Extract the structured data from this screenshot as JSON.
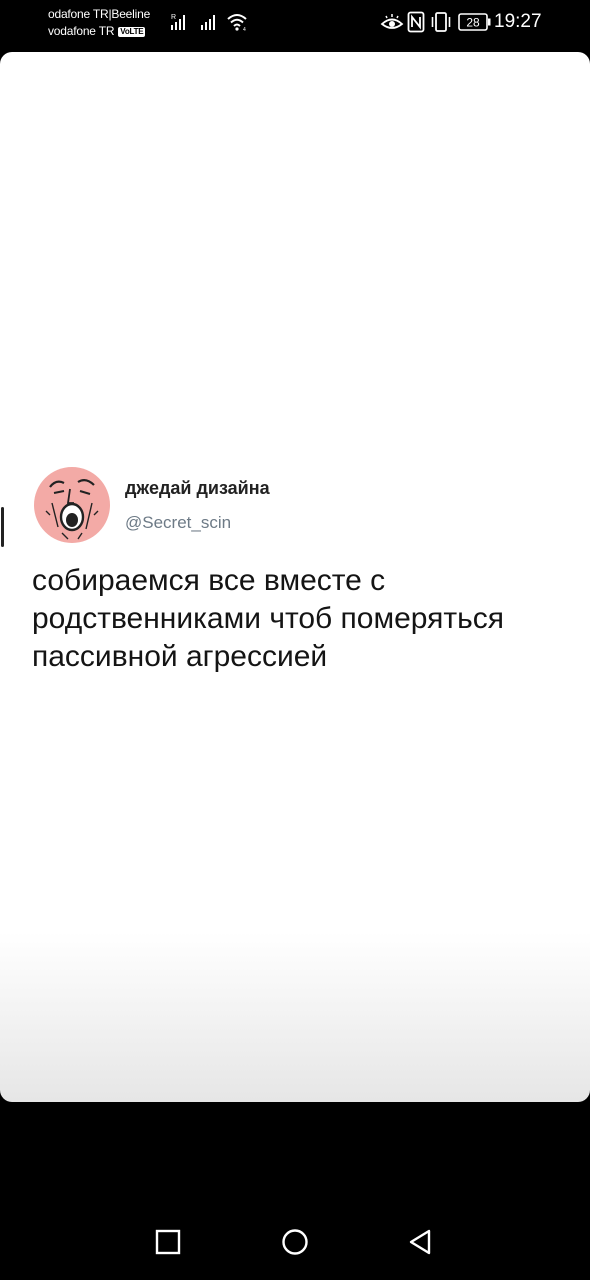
{
  "status_bar": {
    "carrier_line_1": "odafone TR|Beeline",
    "carrier_line_2": "vodafone TR",
    "volte_badge": "VoLTE",
    "sim1_signal_label": "R",
    "battery_level": "28",
    "time": "19:27",
    "icons": [
      "signal-icon",
      "signal-icon",
      "wifi-icon",
      "eye-comfort-icon",
      "nfc-icon",
      "vibrate-icon",
      "battery-icon"
    ]
  },
  "tweet": {
    "display_name": "джедай дизайна",
    "handle": "@Secret_scin",
    "text_lines": [
      "собираемся все вместе с",
      "родственниками чтоб померяться",
      "пассивной агрессией"
    ],
    "avatar_color": "#f3aaa6"
  },
  "nav_bar": {
    "buttons": [
      "recent-apps-button",
      "home-button",
      "back-button"
    ]
  }
}
